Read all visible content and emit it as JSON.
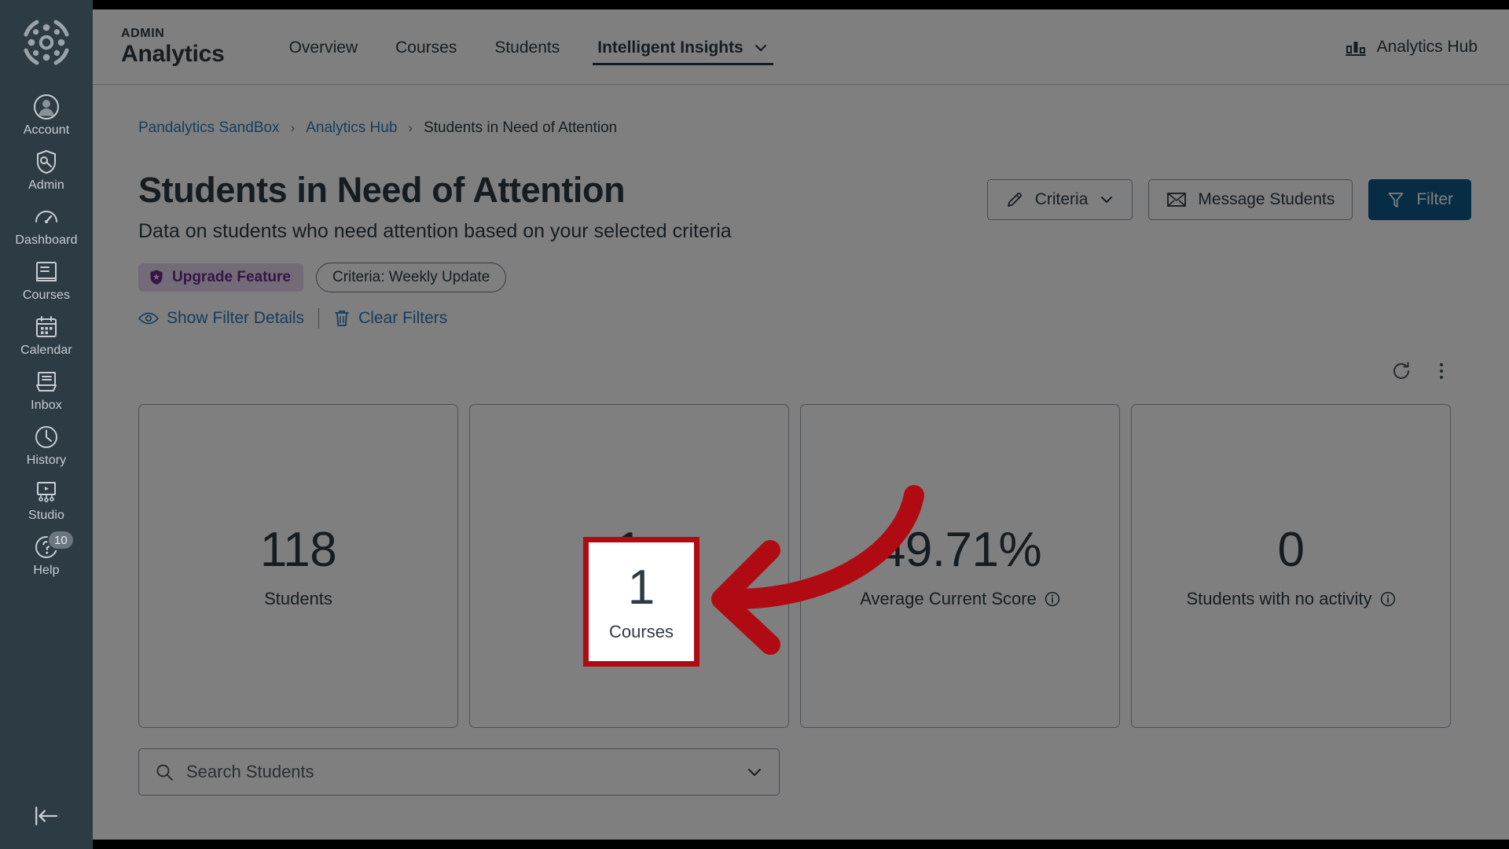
{
  "global_nav": {
    "logo_name": "canvas-logo",
    "items": [
      {
        "label": "Account",
        "icon": "user-avatar-icon"
      },
      {
        "label": "Admin",
        "icon": "shield-wrench-icon"
      },
      {
        "label": "Dashboard",
        "icon": "gauge-icon"
      },
      {
        "label": "Courses",
        "icon": "book-icon"
      },
      {
        "label": "Calendar",
        "icon": "calendar-icon"
      },
      {
        "label": "Inbox",
        "icon": "inbox-tray-icon"
      },
      {
        "label": "History",
        "icon": "clock-icon"
      },
      {
        "label": "Studio",
        "icon": "studio-screen-icon"
      },
      {
        "label": "Help",
        "icon": "question-circle-icon",
        "badge": "10"
      }
    ],
    "collapse_icon": "collapse-left-arrow-icon"
  },
  "appbar": {
    "kicker": "ADMIN",
    "title": "Analytics",
    "nav": [
      {
        "label": "Overview",
        "active": false
      },
      {
        "label": "Courses",
        "active": false
      },
      {
        "label": "Students",
        "active": false
      },
      {
        "label": "Intelligent Insights",
        "active": true,
        "caret": true
      }
    ],
    "hub_label": "Analytics Hub",
    "hub_icon": "bar-chart-icon"
  },
  "breadcrumb": {
    "root": "Pandalytics SandBox",
    "sep": "›",
    "middle": "Analytics Hub",
    "current": "Students in Need of Attention"
  },
  "page": {
    "title": "Students in Need of Attention",
    "subtitle": "Data on students who need attention based on your selected criteria"
  },
  "actions": {
    "criteria_label": "Criteria",
    "criteria_icon": "pencil-icon",
    "criteria_caret": "chevron-down-icon",
    "message_label": "Message Students",
    "message_icon": "envelope-icon",
    "filter_label": "Filter",
    "filter_icon": "funnel-icon",
    "filter_color": "#0E5A8A"
  },
  "pills": {
    "upgrade_label": "Upgrade Feature",
    "upgrade_icon": "shield-star-icon",
    "upgrade_color": "#6A2C8F",
    "criteria_pill": "Criteria: Weekly Update"
  },
  "filter_links": {
    "show_details": "Show Filter Details",
    "show_details_icon": "eye-icon",
    "clear": "Clear Filters",
    "clear_icon": "trash-icon",
    "link_color": "#2B7ABC"
  },
  "toolbar": {
    "refresh_icon": "refresh-icon",
    "more_icon": "kebab-menu-icon"
  },
  "cards": [
    {
      "value": "118",
      "label": "Students",
      "info": false
    },
    {
      "value": "1",
      "label": "Courses",
      "info": false,
      "highlighted": true
    },
    {
      "value": "49.71%",
      "label": "Average Current Score",
      "info": true
    },
    {
      "value": "0",
      "label": "Students with no activity",
      "info": true
    }
  ],
  "annotation": {
    "type": "curved-arrow",
    "color": "#B00B12",
    "points_to": "Courses card",
    "highlight_border_color": "#B00B12"
  },
  "search": {
    "placeholder": "Search Students",
    "icon": "search-icon",
    "caret": "chevron-down-icon"
  }
}
